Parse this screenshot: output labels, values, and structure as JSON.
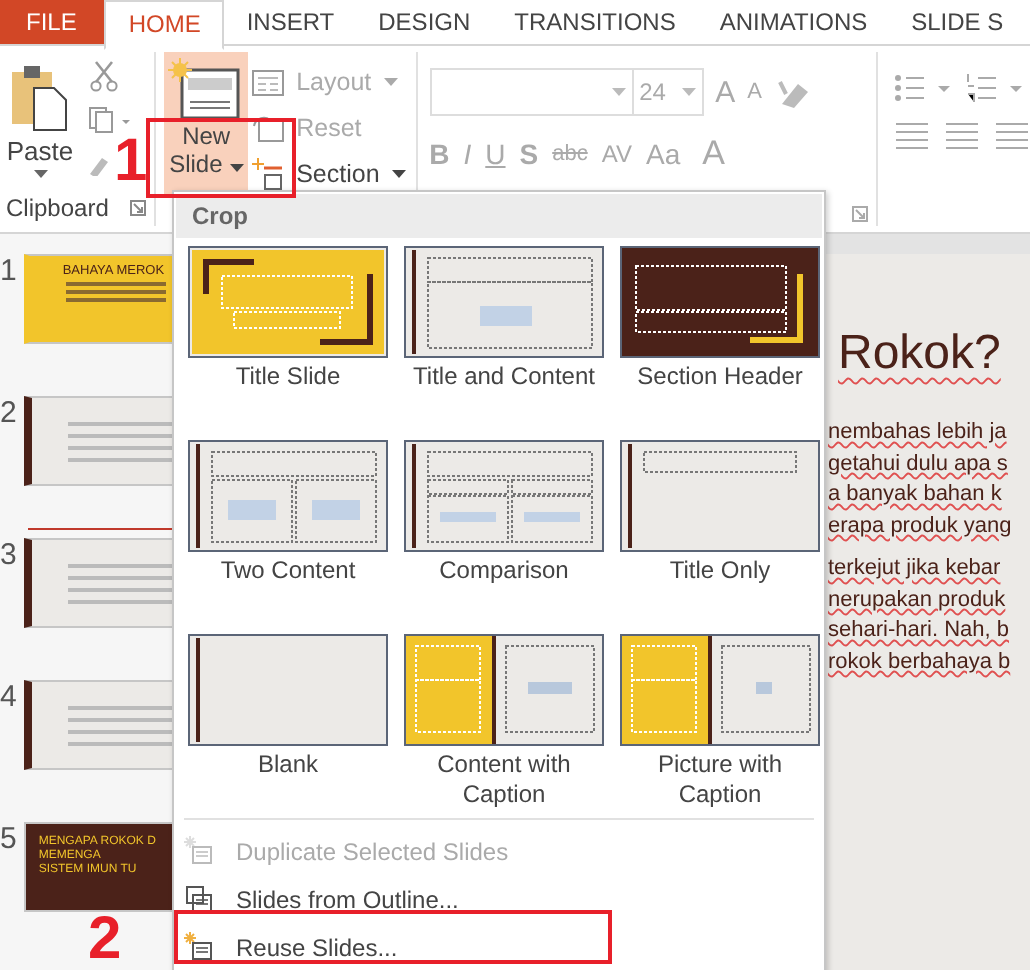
{
  "tabs": [
    {
      "label": "FILE",
      "kind": "file",
      "selected": false
    },
    {
      "label": "HOME",
      "kind": "tab",
      "selected": true
    },
    {
      "label": "INSERT",
      "kind": "tab",
      "selected": false
    },
    {
      "label": "DESIGN",
      "kind": "tab",
      "selected": false
    },
    {
      "label": "TRANSITIONS",
      "kind": "tab",
      "selected": false
    },
    {
      "label": "ANIMATIONS",
      "kind": "tab",
      "selected": false
    },
    {
      "label": "SLIDE S",
      "kind": "tab",
      "selected": false
    }
  ],
  "clipboard": {
    "paste": "Paste",
    "group_label": "Clipboard"
  },
  "slides_group": {
    "new_slide": [
      "New",
      "Slide"
    ],
    "new_slide_open": true,
    "layout": "Layout",
    "reset": "Reset",
    "section": "Section"
  },
  "font_group": {
    "font_size": "24",
    "grow": "A",
    "shrink": "A",
    "format_buttons": [
      "B",
      "I",
      "U",
      "S",
      "abc",
      "AV",
      "Aa"
    ],
    "font_color": "A"
  },
  "slide_thumbnails": [
    {
      "number": "1",
      "kind": "title",
      "title": "BAHAYA MEROK",
      "insert_after": false
    },
    {
      "number": "2",
      "kind": "content",
      "insert_after": true
    },
    {
      "number": "3",
      "kind": "content",
      "insert_after": false
    },
    {
      "number": "4",
      "kind": "content",
      "insert_after": false
    },
    {
      "number": "5",
      "kind": "section",
      "lines": [
        "MENGAPA ROKOK D",
        "MEMENGA",
        "SISTEM IMUN TU"
      ],
      "insert_after": false
    }
  ],
  "editor": {
    "title": "Rokok?",
    "paragraphs": [
      [
        "nembahas lebih ja",
        "getahui dulu apa s",
        "a banyak bahan k",
        "erapa produk yang"
      ],
      [
        "terkejut jika kebar",
        "nerupakan produk",
        "sehari-hari. Nah, b",
        "rokok berbahaya b"
      ]
    ]
  },
  "dropdown": {
    "header": "Crop",
    "layouts": [
      {
        "label": "Title Slide",
        "kind": "title"
      },
      {
        "label": "Title and Content",
        "kind": "title_content"
      },
      {
        "label": "Section Header",
        "kind": "section"
      },
      {
        "label": "Two Content",
        "kind": "two_content"
      },
      {
        "label": "Comparison",
        "kind": "comparison"
      },
      {
        "label": "Title Only",
        "kind": "title_only"
      },
      {
        "label": "Blank",
        "kind": "blank"
      },
      {
        "label": "Content with Caption",
        "kind": "content_caption"
      },
      {
        "label": "Picture with Caption",
        "kind": "picture_caption"
      }
    ],
    "menu_items": [
      {
        "label": "Duplicate Selected Slides",
        "kind": "duplicate",
        "disabled": true
      },
      {
        "label": "Slides from Outline...",
        "kind": "outline",
        "disabled": false
      },
      {
        "label": "Reuse Slides...",
        "kind": "reuse",
        "disabled": false
      }
    ]
  },
  "annotations": [
    {
      "label": "1",
      "kind": "new_slide"
    },
    {
      "label": "2",
      "kind": "reuse"
    }
  ]
}
